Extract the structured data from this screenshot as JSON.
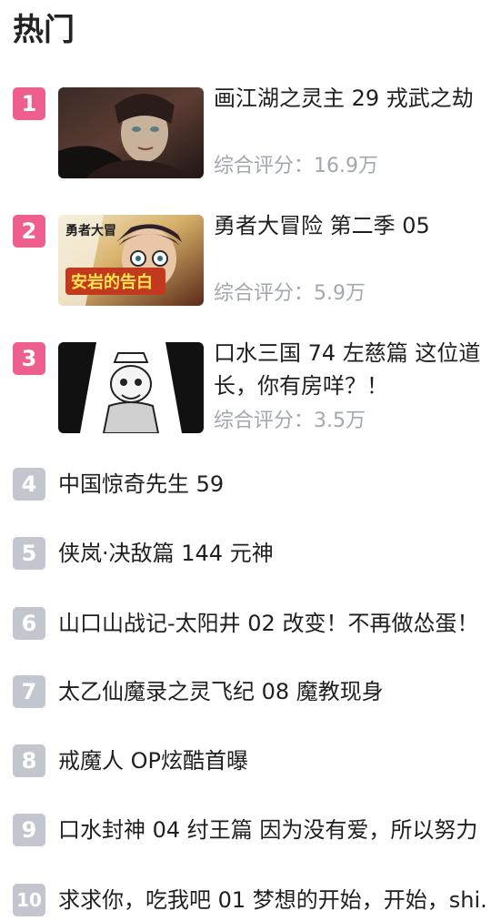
{
  "header": {
    "title": "热门"
  },
  "top_items": [
    {
      "rank": "1",
      "title": "画江湖之灵主 29 戎武之劫",
      "score": "综合评分：16.9万",
      "thumbnail_text": ""
    },
    {
      "rank": "2",
      "title": "勇者大冒险 第二季 05",
      "score": "综合评分：5.9万",
      "thumbnail_text": "安岩的告白"
    },
    {
      "rank": "3",
      "title": "口水三国 74 左慈篇 这位道长，你有房咩？！",
      "score": "综合评分：3.5万",
      "thumbnail_text": ""
    }
  ],
  "list_items": [
    {
      "rank": "4",
      "title": "中国惊奇先生 59"
    },
    {
      "rank": "5",
      "title": "侠岚·决敌篇 144 元神"
    },
    {
      "rank": "6",
      "title": "山口山战记-太阳井 02 改变！不再做怂蛋！"
    },
    {
      "rank": "7",
      "title": "太乙仙魔录之灵飞纪 08 魔教现身"
    },
    {
      "rank": "8",
      "title": "戒魔人 OP炫酷首曝"
    },
    {
      "rank": "9",
      "title": "口水封神 04 纣王篇 因为没有爱，所以努力"
    },
    {
      "rank": "10",
      "title": "求求你，吃我吧 01 梦想的开始，开始，shi."
    }
  ],
  "colors": {
    "top_badge": "#ee5f8d",
    "list_badge": "#c2c6cf",
    "score_text": "#a3a8b0",
    "title_text": "#1f1f1f"
  }
}
